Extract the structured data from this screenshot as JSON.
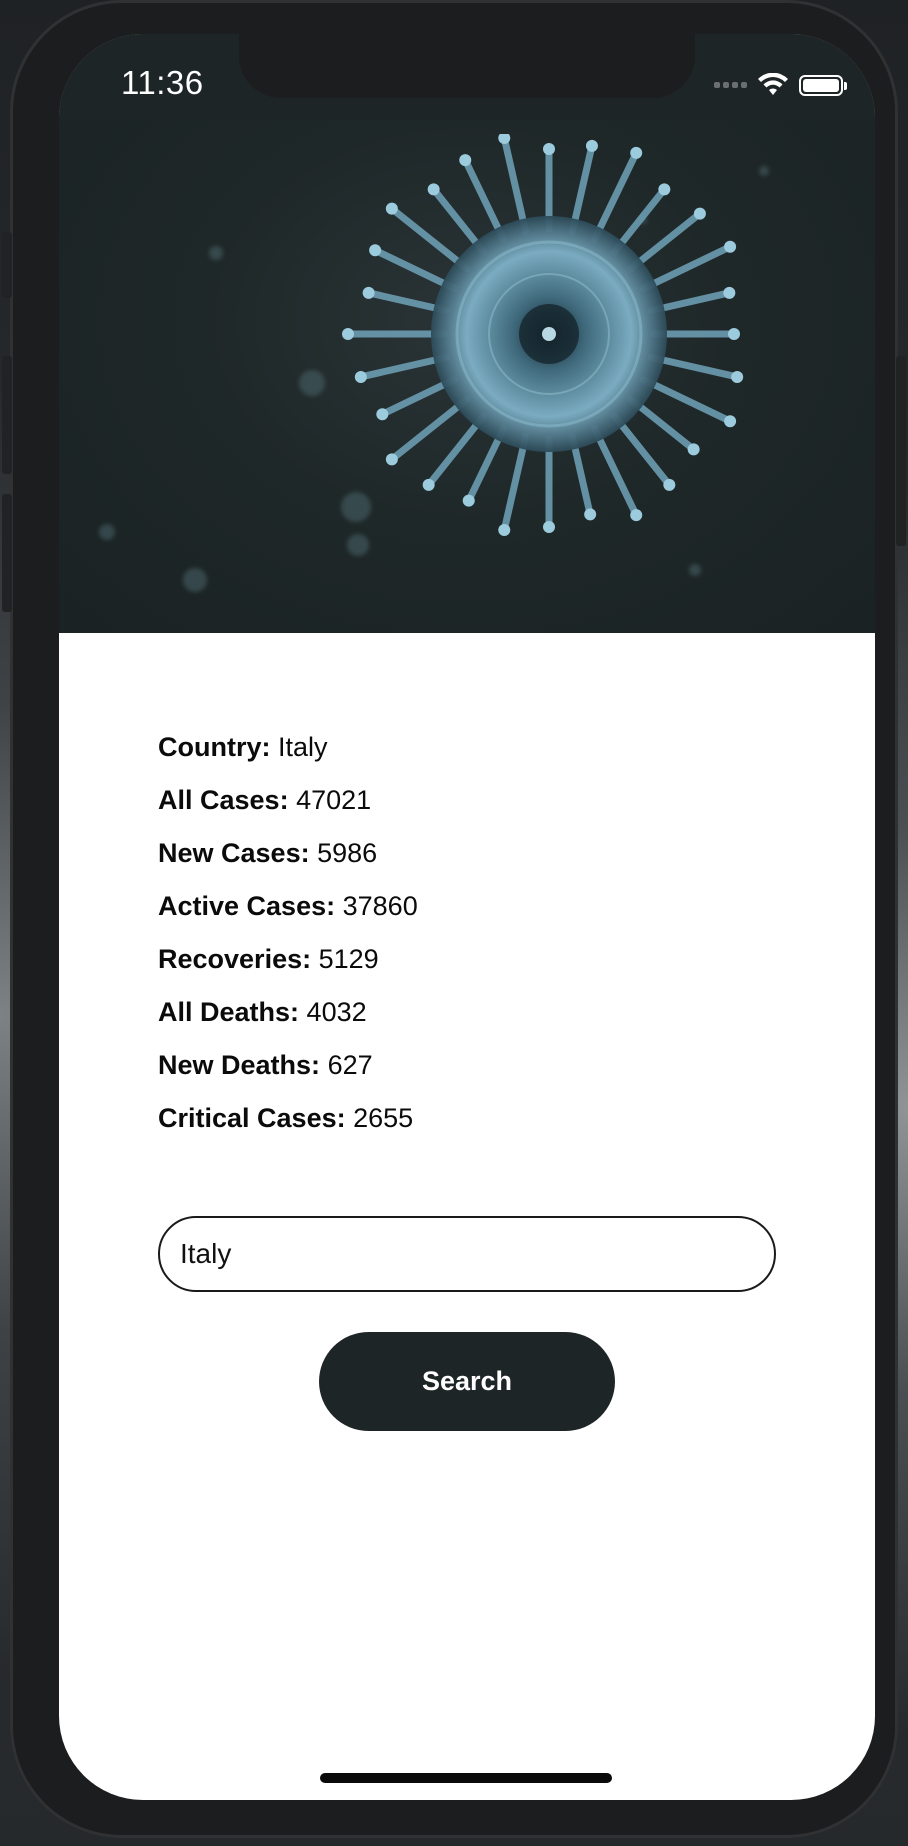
{
  "status_bar": {
    "time": "11:36",
    "icons": [
      "signal-dots-icon",
      "wifi-icon",
      "battery-icon"
    ]
  },
  "hero": {
    "image": "coronavirus-illustration"
  },
  "stats": [
    {
      "label": "Country:",
      "value": "Italy"
    },
    {
      "label": "All Cases:",
      "value": "47021"
    },
    {
      "label": "New Cases:",
      "value": "5986"
    },
    {
      "label": "Active Cases:",
      "value": "37860"
    },
    {
      "label": "Recoveries:",
      "value": "5129"
    },
    {
      "label": "All Deaths:",
      "value": "4032"
    },
    {
      "label": "New Deaths:",
      "value": "627"
    },
    {
      "label": "Critical Cases:",
      "value": "2655"
    }
  ],
  "search": {
    "value": "Italy",
    "button_label": "Search"
  },
  "colors": {
    "hero_background": "#1f2829",
    "button_background": "#1e2526",
    "button_text": "#ffffff",
    "text": "#0b0b0b"
  }
}
